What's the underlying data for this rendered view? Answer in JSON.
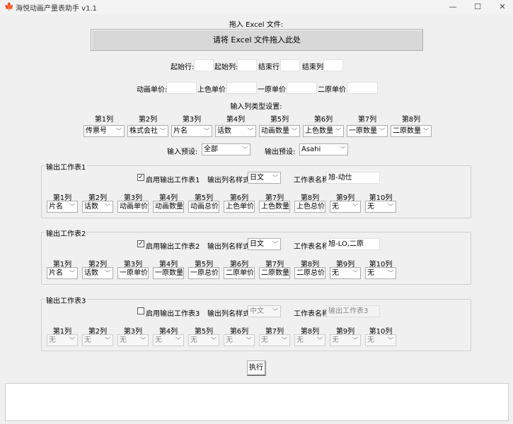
{
  "window": {
    "title": "海悦动画产量表助手 v1.1",
    "minimize": "—",
    "maximize": "☐",
    "close": "✕"
  },
  "drop": {
    "label": "拖入 Excel 文件:",
    "button": "请将 Excel 文件拖入此处"
  },
  "range": {
    "start_row": "起始行:",
    "start_col": "起始列:",
    "end_row": "结束行:",
    "end_col": "结束列:"
  },
  "prices": {
    "anim": "动画单价:",
    "color": "上色单价:",
    "first": "一原单价:",
    "second": "二原单价:"
  },
  "input_types": {
    "title": "输入列类型设置:",
    "columns": [
      {
        "label": "第1列",
        "value": "传票号"
      },
      {
        "label": "第2列",
        "value": "株式会社"
      },
      {
        "label": "第3列",
        "value": "片名"
      },
      {
        "label": "第4列",
        "value": "话数"
      },
      {
        "label": "第5列",
        "value": "动画数量"
      },
      {
        "label": "第6列",
        "value": "上色数量"
      },
      {
        "label": "第7列",
        "value": "一原数量"
      },
      {
        "label": "第8列",
        "value": "二原数量"
      }
    ]
  },
  "presets": {
    "input_label": "输入预设:",
    "input_value": "全部",
    "output_label": "输出预设:",
    "output_value": "Asahi"
  },
  "sheets": [
    {
      "title": "输出工作表1",
      "enable_label": "启用输出工作表1",
      "enabled": true,
      "style_label": "输出列名样式:",
      "style_value": "日文",
      "name_label": "工作表名称:",
      "name_value": "旭-动仕",
      "columns": [
        {
          "label": "第1列",
          "value": "片名"
        },
        {
          "label": "第2列",
          "value": "话数"
        },
        {
          "label": "第3列",
          "value": "动画单价"
        },
        {
          "label": "第4列",
          "value": "动画数量"
        },
        {
          "label": "第5列",
          "value": "动画总价"
        },
        {
          "label": "第6列",
          "value": "上色单价"
        },
        {
          "label": "第7列",
          "value": "上色数量"
        },
        {
          "label": "第8列",
          "value": "上色总价"
        },
        {
          "label": "第9列",
          "value": "无"
        },
        {
          "label": "第10列",
          "value": "无"
        }
      ]
    },
    {
      "title": "输出工作表2",
      "enable_label": "启用输出工作表2",
      "enabled": true,
      "style_label": "输出列名样式:",
      "style_value": "日文",
      "name_label": "工作表名称:",
      "name_value": "旭-LO,二原",
      "columns": [
        {
          "label": "第1列",
          "value": "片名"
        },
        {
          "label": "第2列",
          "value": "话数"
        },
        {
          "label": "第3列",
          "value": "一原单价"
        },
        {
          "label": "第4列",
          "value": "一原数量"
        },
        {
          "label": "第5列",
          "value": "一原总价"
        },
        {
          "label": "第6列",
          "value": "二原单价"
        },
        {
          "label": "第7列",
          "value": "二原数量"
        },
        {
          "label": "第8列",
          "value": "二原总价"
        },
        {
          "label": "第9列",
          "value": "无"
        },
        {
          "label": "第10列",
          "value": "无"
        }
      ]
    },
    {
      "title": "输出工作表3",
      "enable_label": "启用输出工作表3",
      "enabled": false,
      "style_label": "输出列名样式:",
      "style_value": "中文",
      "name_label": "工作表名称:",
      "name_value": "输出工作表3",
      "columns": [
        {
          "label": "第1列",
          "value": "无"
        },
        {
          "label": "第2列",
          "value": "无"
        },
        {
          "label": "第3列",
          "value": "无"
        },
        {
          "label": "第4列",
          "value": "无"
        },
        {
          "label": "第5列",
          "value": "无"
        },
        {
          "label": "第6列",
          "value": "无"
        },
        {
          "label": "第7列",
          "value": "无"
        },
        {
          "label": "第8列",
          "value": "无"
        },
        {
          "label": "第9列",
          "value": "无"
        },
        {
          "label": "第10列",
          "value": "无"
        }
      ]
    }
  ],
  "run_button": "执行",
  "output_text": ""
}
